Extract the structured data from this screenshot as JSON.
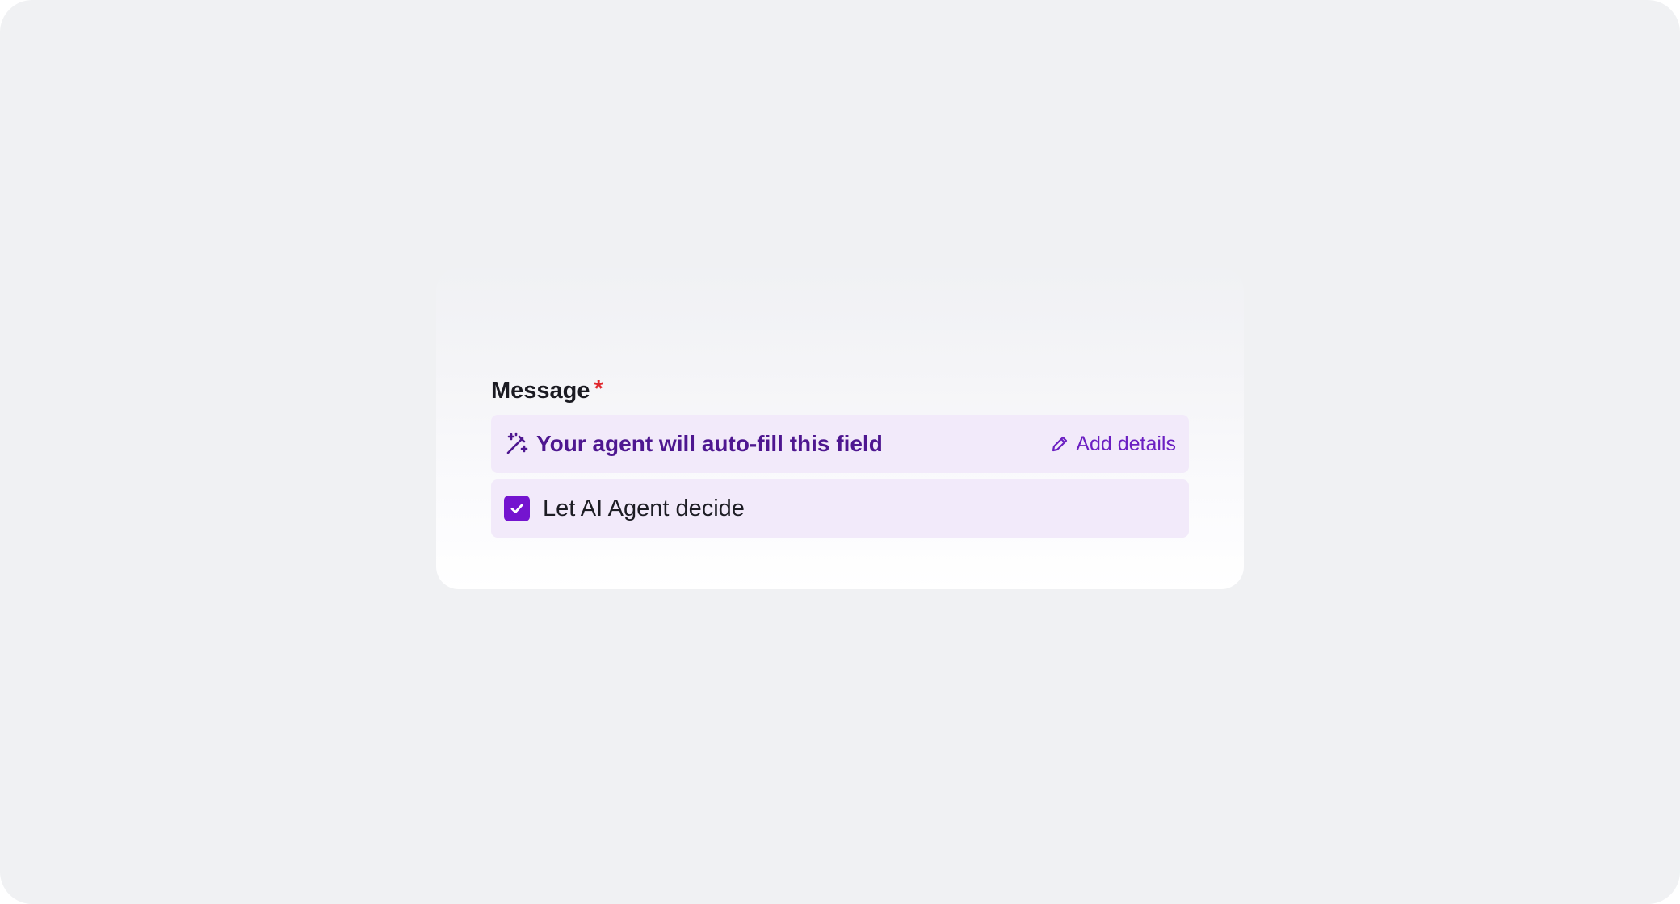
{
  "field": {
    "label": "Message",
    "required_marker": "*"
  },
  "autofill": {
    "icon": "magic-wand-icon",
    "text": "Your agent will auto-fill this field",
    "action_icon": "pencil-icon",
    "action_label": "Add details"
  },
  "ai_decide": {
    "checked": true,
    "label": "Let AI Agent decide"
  },
  "colors": {
    "accent": "#7414cf",
    "accent_text": "#4e1790",
    "link": "#6b1fc2",
    "panel_bg": "#f2eafa",
    "required": "#e0282e",
    "page_bg": "#f0f1f3"
  }
}
